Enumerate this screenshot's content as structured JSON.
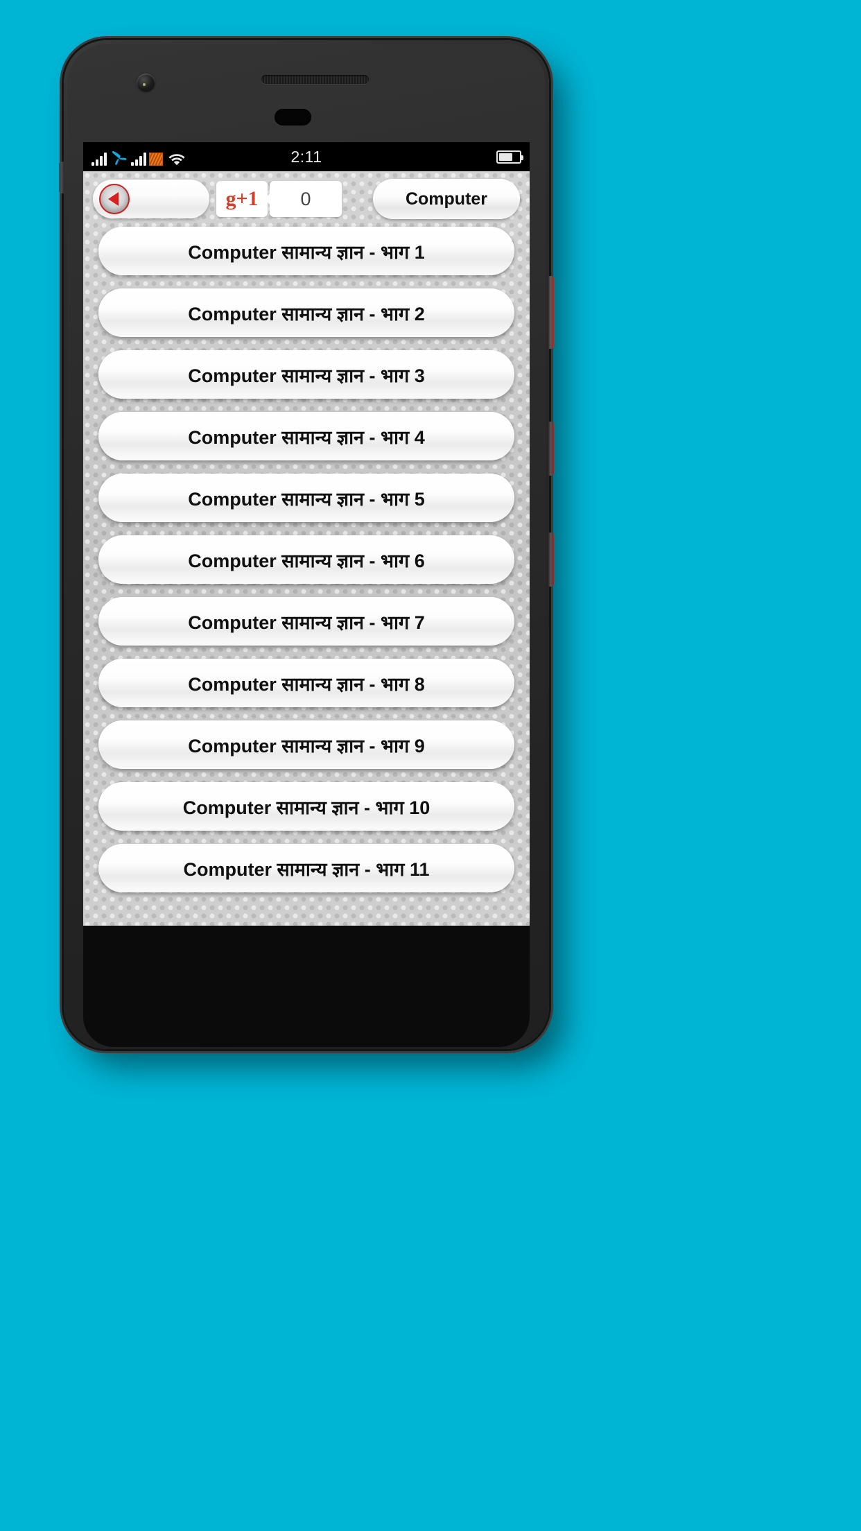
{
  "theme": {
    "page_background": "#00b4d4",
    "accent_red": "#d62222",
    "gplus_red": "#d2402a",
    "carrier_logo_blue": "#17a7dd",
    "data_icon_orange": "#f07d1c"
  },
  "status_bar": {
    "clock": "2:11",
    "icons": [
      "signal-bars-icon",
      "carrier-logo-icon",
      "signal-bars-icon",
      "data-activity-icon",
      "wifi-icon",
      "battery-icon"
    ]
  },
  "toolbar": {
    "back_button_name": "back-button",
    "back_icon": "back-arrow-icon",
    "gplus_label": "+1",
    "gplus_g": "g",
    "gplus_count": "0",
    "category_label": "Computer"
  },
  "topic_list": {
    "items": [
      {
        "label": "Computer सामान्य ज्ञान - भाग 1"
      },
      {
        "label": "Computer सामान्य ज्ञान - भाग 2"
      },
      {
        "label": "Computer सामान्य ज्ञान - भाग 3"
      },
      {
        "label": "Computer सामान्य ज्ञान - भाग 4"
      },
      {
        "label": "Computer सामान्य ज्ञान - भाग 5"
      },
      {
        "label": "Computer सामान्य ज्ञान - भाग 6"
      },
      {
        "label": "Computer सामान्य ज्ञान - भाग 7"
      },
      {
        "label": "Computer सामान्य ज्ञान - भाग 8"
      },
      {
        "label": "Computer सामान्य ज्ञान - भाग 9"
      },
      {
        "label": "Computer सामान्य ज्ञान - भाग 10"
      },
      {
        "label": "Computer सामान्य ज्ञान - भाग 11"
      }
    ]
  }
}
